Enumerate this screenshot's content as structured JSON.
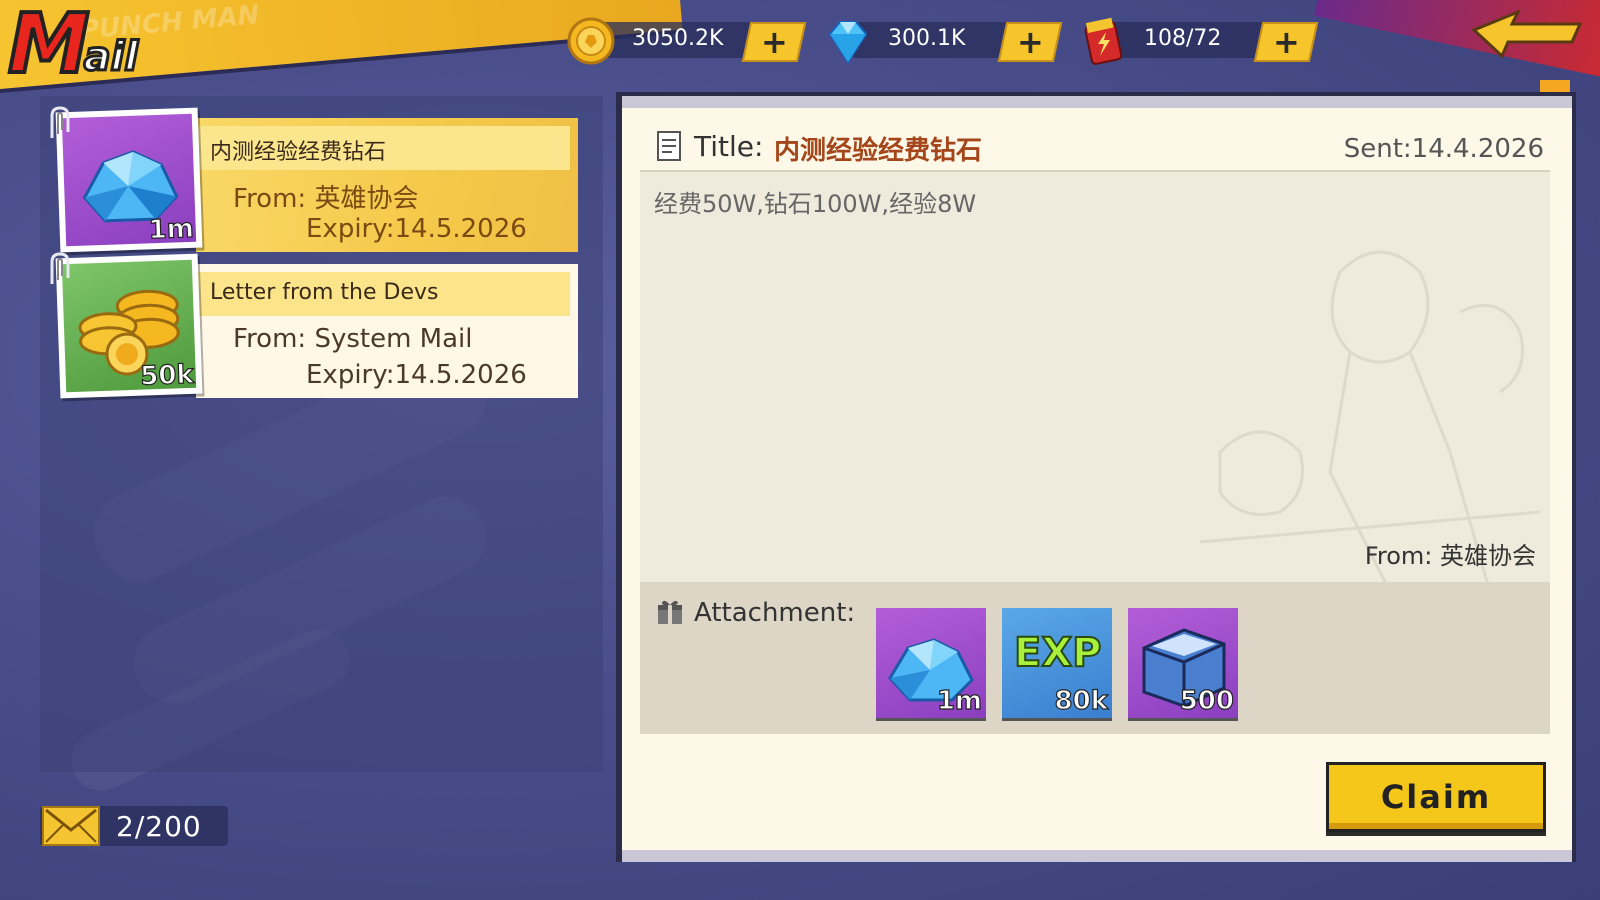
{
  "header": {
    "logo_big": "M",
    "logo_small": "ail",
    "banner_ghost": "PUNCH MAN"
  },
  "currencies": [
    {
      "name": "coin-icon",
      "value": "3050.2K",
      "plus": "+"
    },
    {
      "name": "diamond-icon",
      "value": "300.1K",
      "plus": "+"
    },
    {
      "name": "energy-icon",
      "value": "108/72",
      "plus": "+"
    }
  ],
  "mail_list": [
    {
      "title": "内测经验经费钻石",
      "from": "From: 英雄协会",
      "expiry": "Expiry:14.5.2026",
      "thumb_amount": "1m",
      "thumb_icon": "diamond-pile-icon",
      "selected": true
    },
    {
      "title": "Letter from the Devs",
      "from": "From: System Mail",
      "expiry": "Expiry:14.5.2026",
      "thumb_amount": "50k",
      "thumb_icon": "gold-coins-icon",
      "selected": false
    }
  ],
  "mail_counter": {
    "value": "2/200"
  },
  "detail": {
    "title_label": "Title:",
    "title_value": "内测经验经费钻石",
    "sent": "Sent:14.4.2026",
    "message": "经费50W,钻石100W,经验8W",
    "from": "From: 英雄协会",
    "attachment_label": "Attachment:",
    "attachments": [
      {
        "icon": "diamond-pile-icon",
        "amount": "1m"
      },
      {
        "icon": "exp-icon",
        "amount": "80k",
        "label": "EXP"
      },
      {
        "icon": "chest-icon",
        "amount": "500"
      }
    ],
    "claim_label": "Claim"
  },
  "colors": {
    "accent_gold": "#f5c71a",
    "panel_cream": "#fdf8e8",
    "title_brown": "#a4461a",
    "bg_purple": "#4a4f8c"
  }
}
